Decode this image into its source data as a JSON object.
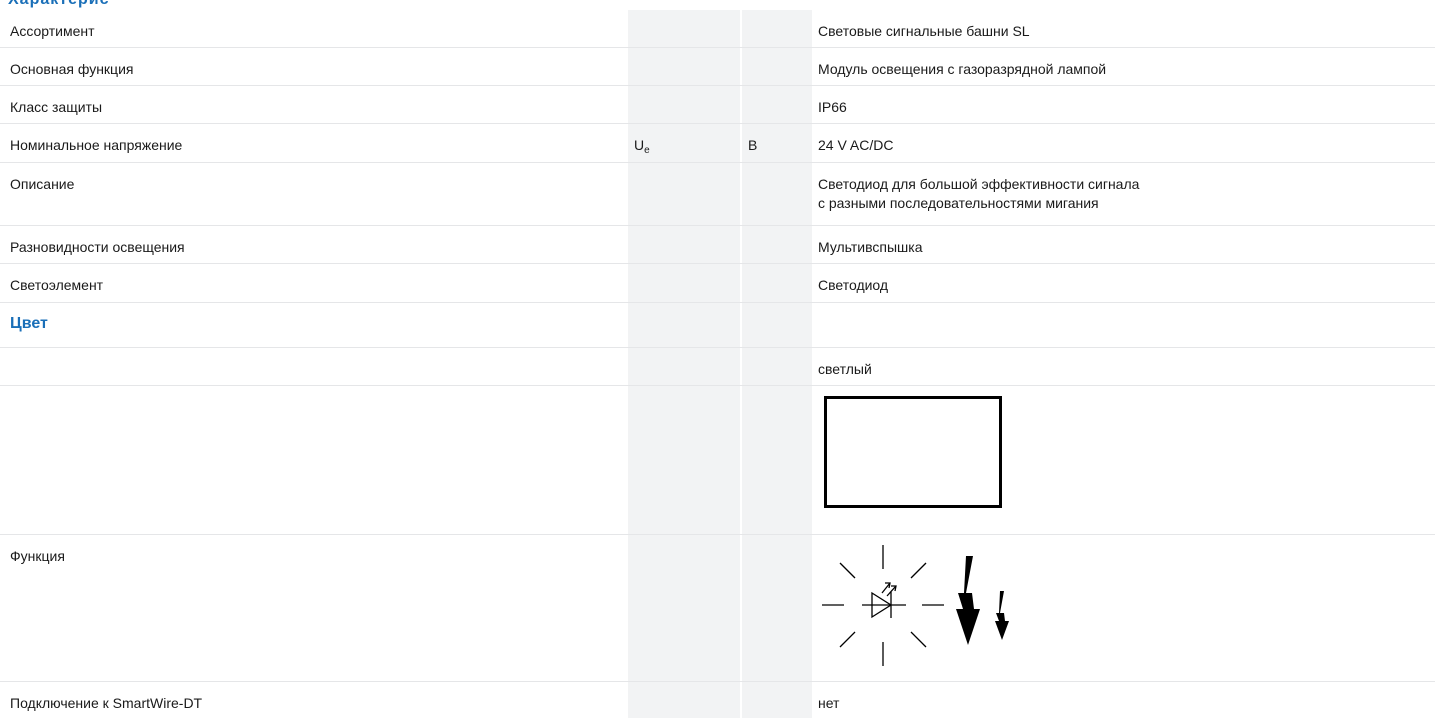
{
  "header": {
    "title_fragment": "Характеристики"
  },
  "rows": [
    {
      "label": "Ассортимент",
      "value": "Световые сигнальные башни SL"
    },
    {
      "label": "Основная функция",
      "value": "Модуль освещения с газоразрядной лампой"
    },
    {
      "label": "Класс защиты",
      "value": "IP66"
    },
    {
      "label": "Номинальное напряжение",
      "symbol": "U",
      "symbol_sub": "e",
      "unit": "В",
      "value": "24 V AC/DC"
    },
    {
      "label": "Описание",
      "value_line1": "Светодиод для большой эффективности сигнала",
      "value_line2": "с разными последовательностями мигания"
    },
    {
      "label": "Разновидности освещения",
      "value": "Мультивспышка"
    },
    {
      "label": "Светоэлемент",
      "value": "Светодиод"
    },
    {
      "label": "Функция"
    },
    {
      "label": "Подключение к SmartWire-DT",
      "value": "нет"
    }
  ],
  "color_section": {
    "heading": "Цвет",
    "value": "светлый"
  },
  "colors": {
    "accent": "#1a6fb8",
    "shade": "#f2f3f4",
    "divider": "#e5e6e8"
  },
  "icons": {
    "lamp": "lamp-color-swatch",
    "function": "multi-flash-led-icon"
  }
}
